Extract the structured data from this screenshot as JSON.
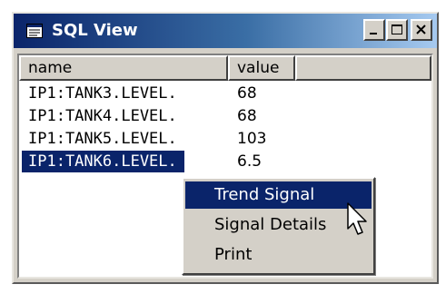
{
  "window": {
    "title": "SQL View",
    "icon": "sql-view-icon",
    "controls": {
      "minimize": "minimize-icon",
      "maximize": "maximize-icon",
      "close": "close-icon"
    }
  },
  "table": {
    "columns": [
      "name",
      "value"
    ],
    "rows": [
      {
        "name": "IP1:TANK3.LEVEL.",
        "value": "68"
      },
      {
        "name": "IP1:TANK4.LEVEL.",
        "value": "68"
      },
      {
        "name": "IP1:TANK5.LEVEL.",
        "value": "103"
      },
      {
        "name": "IP1:TANK6.LEVEL.",
        "value": "6.5",
        "selected": true
      }
    ]
  },
  "context_menu": {
    "items": [
      "Trend Signal",
      "Signal Details",
      "Print"
    ],
    "active": "Trend Signal"
  },
  "colors": {
    "title_gradient_start": "#0a246a",
    "title_gradient_end": "#a6caf0",
    "selection": "#0a246a",
    "face": "#d4d0c8"
  },
  "cursor": "arrow-cursor-icon"
}
